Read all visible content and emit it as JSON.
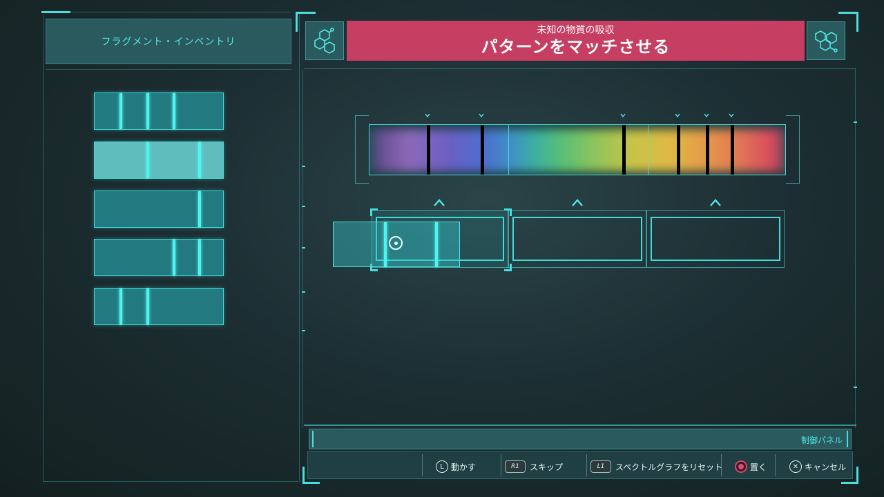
{
  "inventory": {
    "title": "フラグメント・インベントリ",
    "fragments": [
      {
        "lines": [
          0.2,
          0.41,
          0.61
        ],
        "selected": false
      },
      {
        "lines": [
          0.41,
          0.81
        ],
        "selected": true
      },
      {
        "lines": [
          0.81
        ],
        "selected": false
      },
      {
        "lines": [
          0.61,
          0.81
        ],
        "selected": false
      },
      {
        "lines": [
          0.2,
          0.41
        ],
        "selected": false
      }
    ]
  },
  "header": {
    "subtitle": "未知の物質の吸収",
    "title": "パターンをマッチさせる",
    "left_icon": "hexagon-molecule-icon",
    "right_icon": "hexagon-molecule-icon"
  },
  "spectrum": {
    "segments": 3,
    "target_lines": [
      0.14,
      0.27,
      0.61,
      0.74,
      0.81,
      0.87
    ]
  },
  "slots": {
    "count": 3,
    "marker_icon": "chevron-up-icon"
  },
  "dragged_fragment": {
    "lines": [
      0.41,
      0.81
    ]
  },
  "control_panel": {
    "label": "制御パネル",
    "buttons": [
      {
        "icon": "L",
        "label": "動かす"
      },
      {
        "icon": "R1",
        "label": "スキップ"
      },
      {
        "icon": "L1",
        "label": "スペクトルグラフをリセット"
      },
      {
        "icon": "circle",
        "label": "置く"
      },
      {
        "icon": "cross",
        "label": "キャンセル"
      }
    ]
  },
  "colors": {
    "accent": "#47e0e0",
    "banner": "#c63e62"
  }
}
